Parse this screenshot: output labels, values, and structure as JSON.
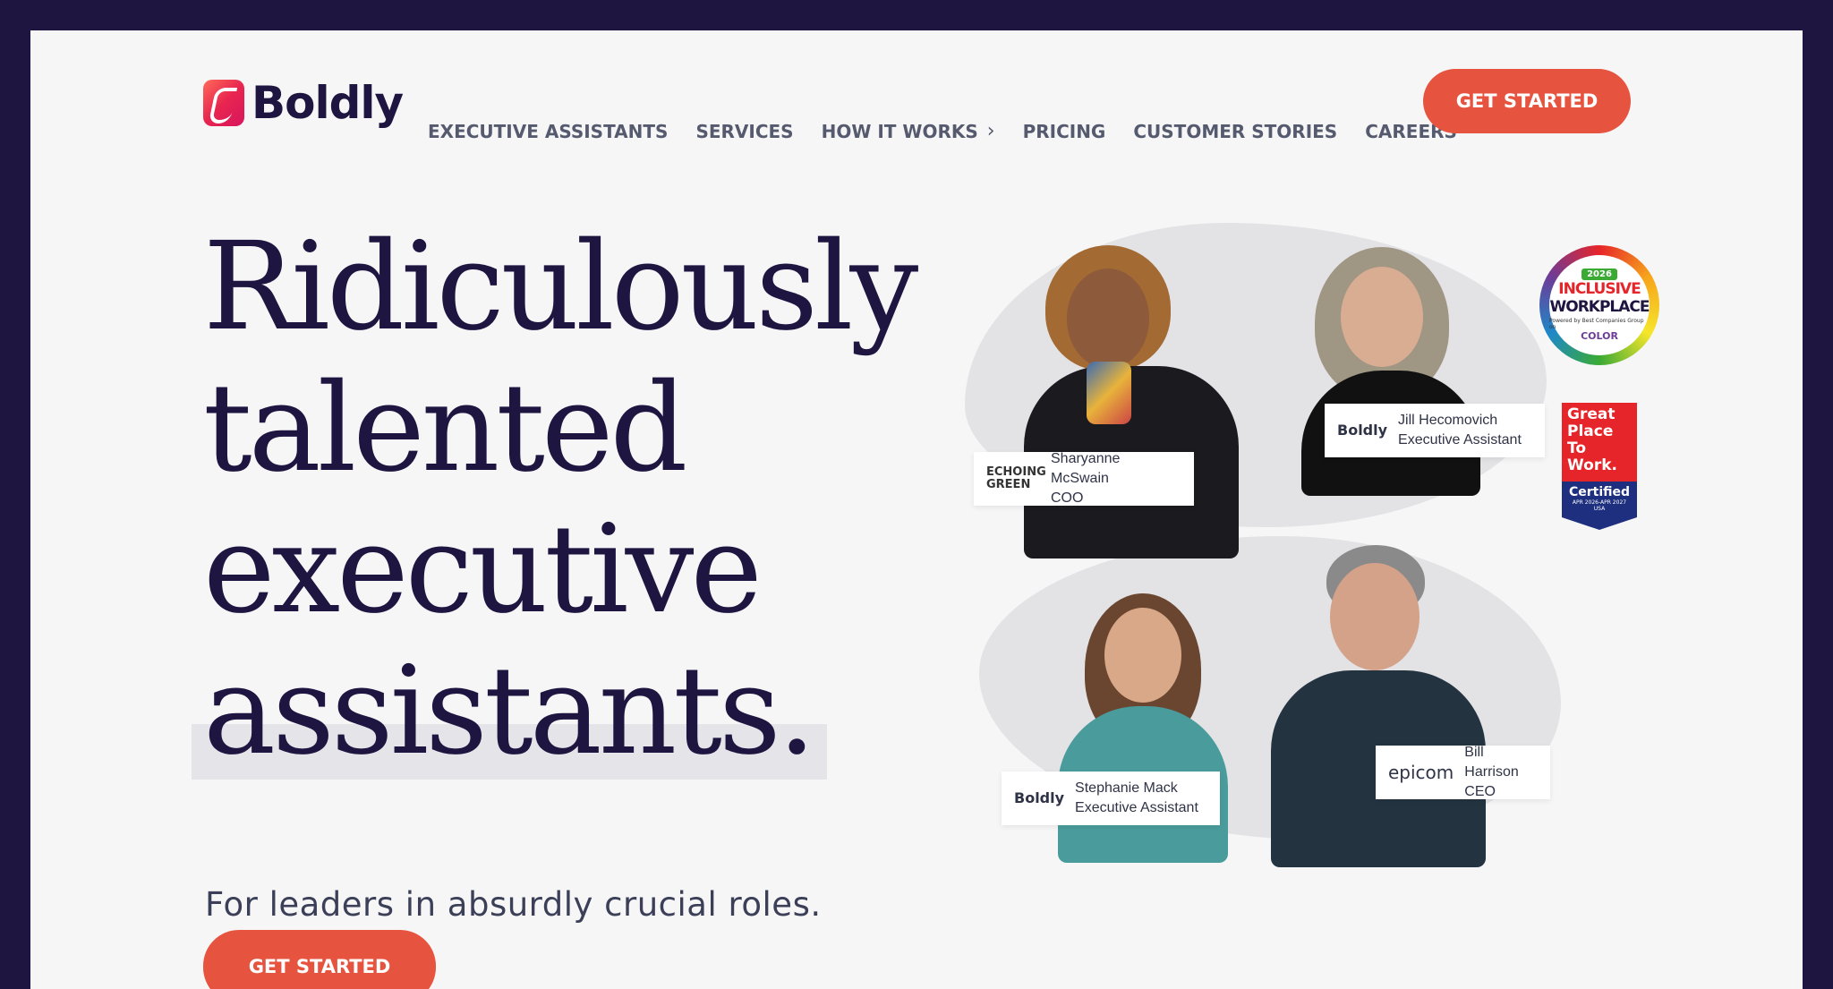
{
  "brand": {
    "name": "Boldly"
  },
  "nav": {
    "items": [
      "EXECUTIVE ASSISTANTS",
      "SERVICES",
      "HOW IT WORKS",
      "PRICING",
      "CUSTOMER STORIES",
      "CAREERS"
    ],
    "cta": "GET STARTED"
  },
  "hero": {
    "headline": [
      "Ridiculously",
      "talented",
      "executive",
      "assistants."
    ],
    "subhead": "For leaders in absurdly crucial roles.",
    "cta": "GET STARTED"
  },
  "people": [
    {
      "name": "Sharyanne McSwain",
      "title": "COO",
      "company": "ECHOING GREEN"
    },
    {
      "name": "Jill Hecomovich",
      "title": "Executive Assistant",
      "company": "Boldly"
    },
    {
      "name": "Stephanie Mack",
      "title": "Executive Assistant",
      "company": "Boldly"
    },
    {
      "name": "Bill Harrison",
      "title": "CEO",
      "company": "epicom"
    }
  ],
  "badges": {
    "inclusive": {
      "year": "2026",
      "line1": "INCLUSIVE",
      "line2": "WORKPLACE",
      "small": "Powered by Best Companies Group on",
      "color": "COLOR"
    },
    "gptw": {
      "line1": "Great",
      "line2": "Place",
      "line3": "To",
      "line4": "Work.",
      "certified": "Certified",
      "dates": "APR 2026-APR 2027",
      "country": "USA"
    }
  },
  "colors": {
    "accent": "#e65440",
    "navy": "#1e1540",
    "background": "#f6f6f7"
  }
}
